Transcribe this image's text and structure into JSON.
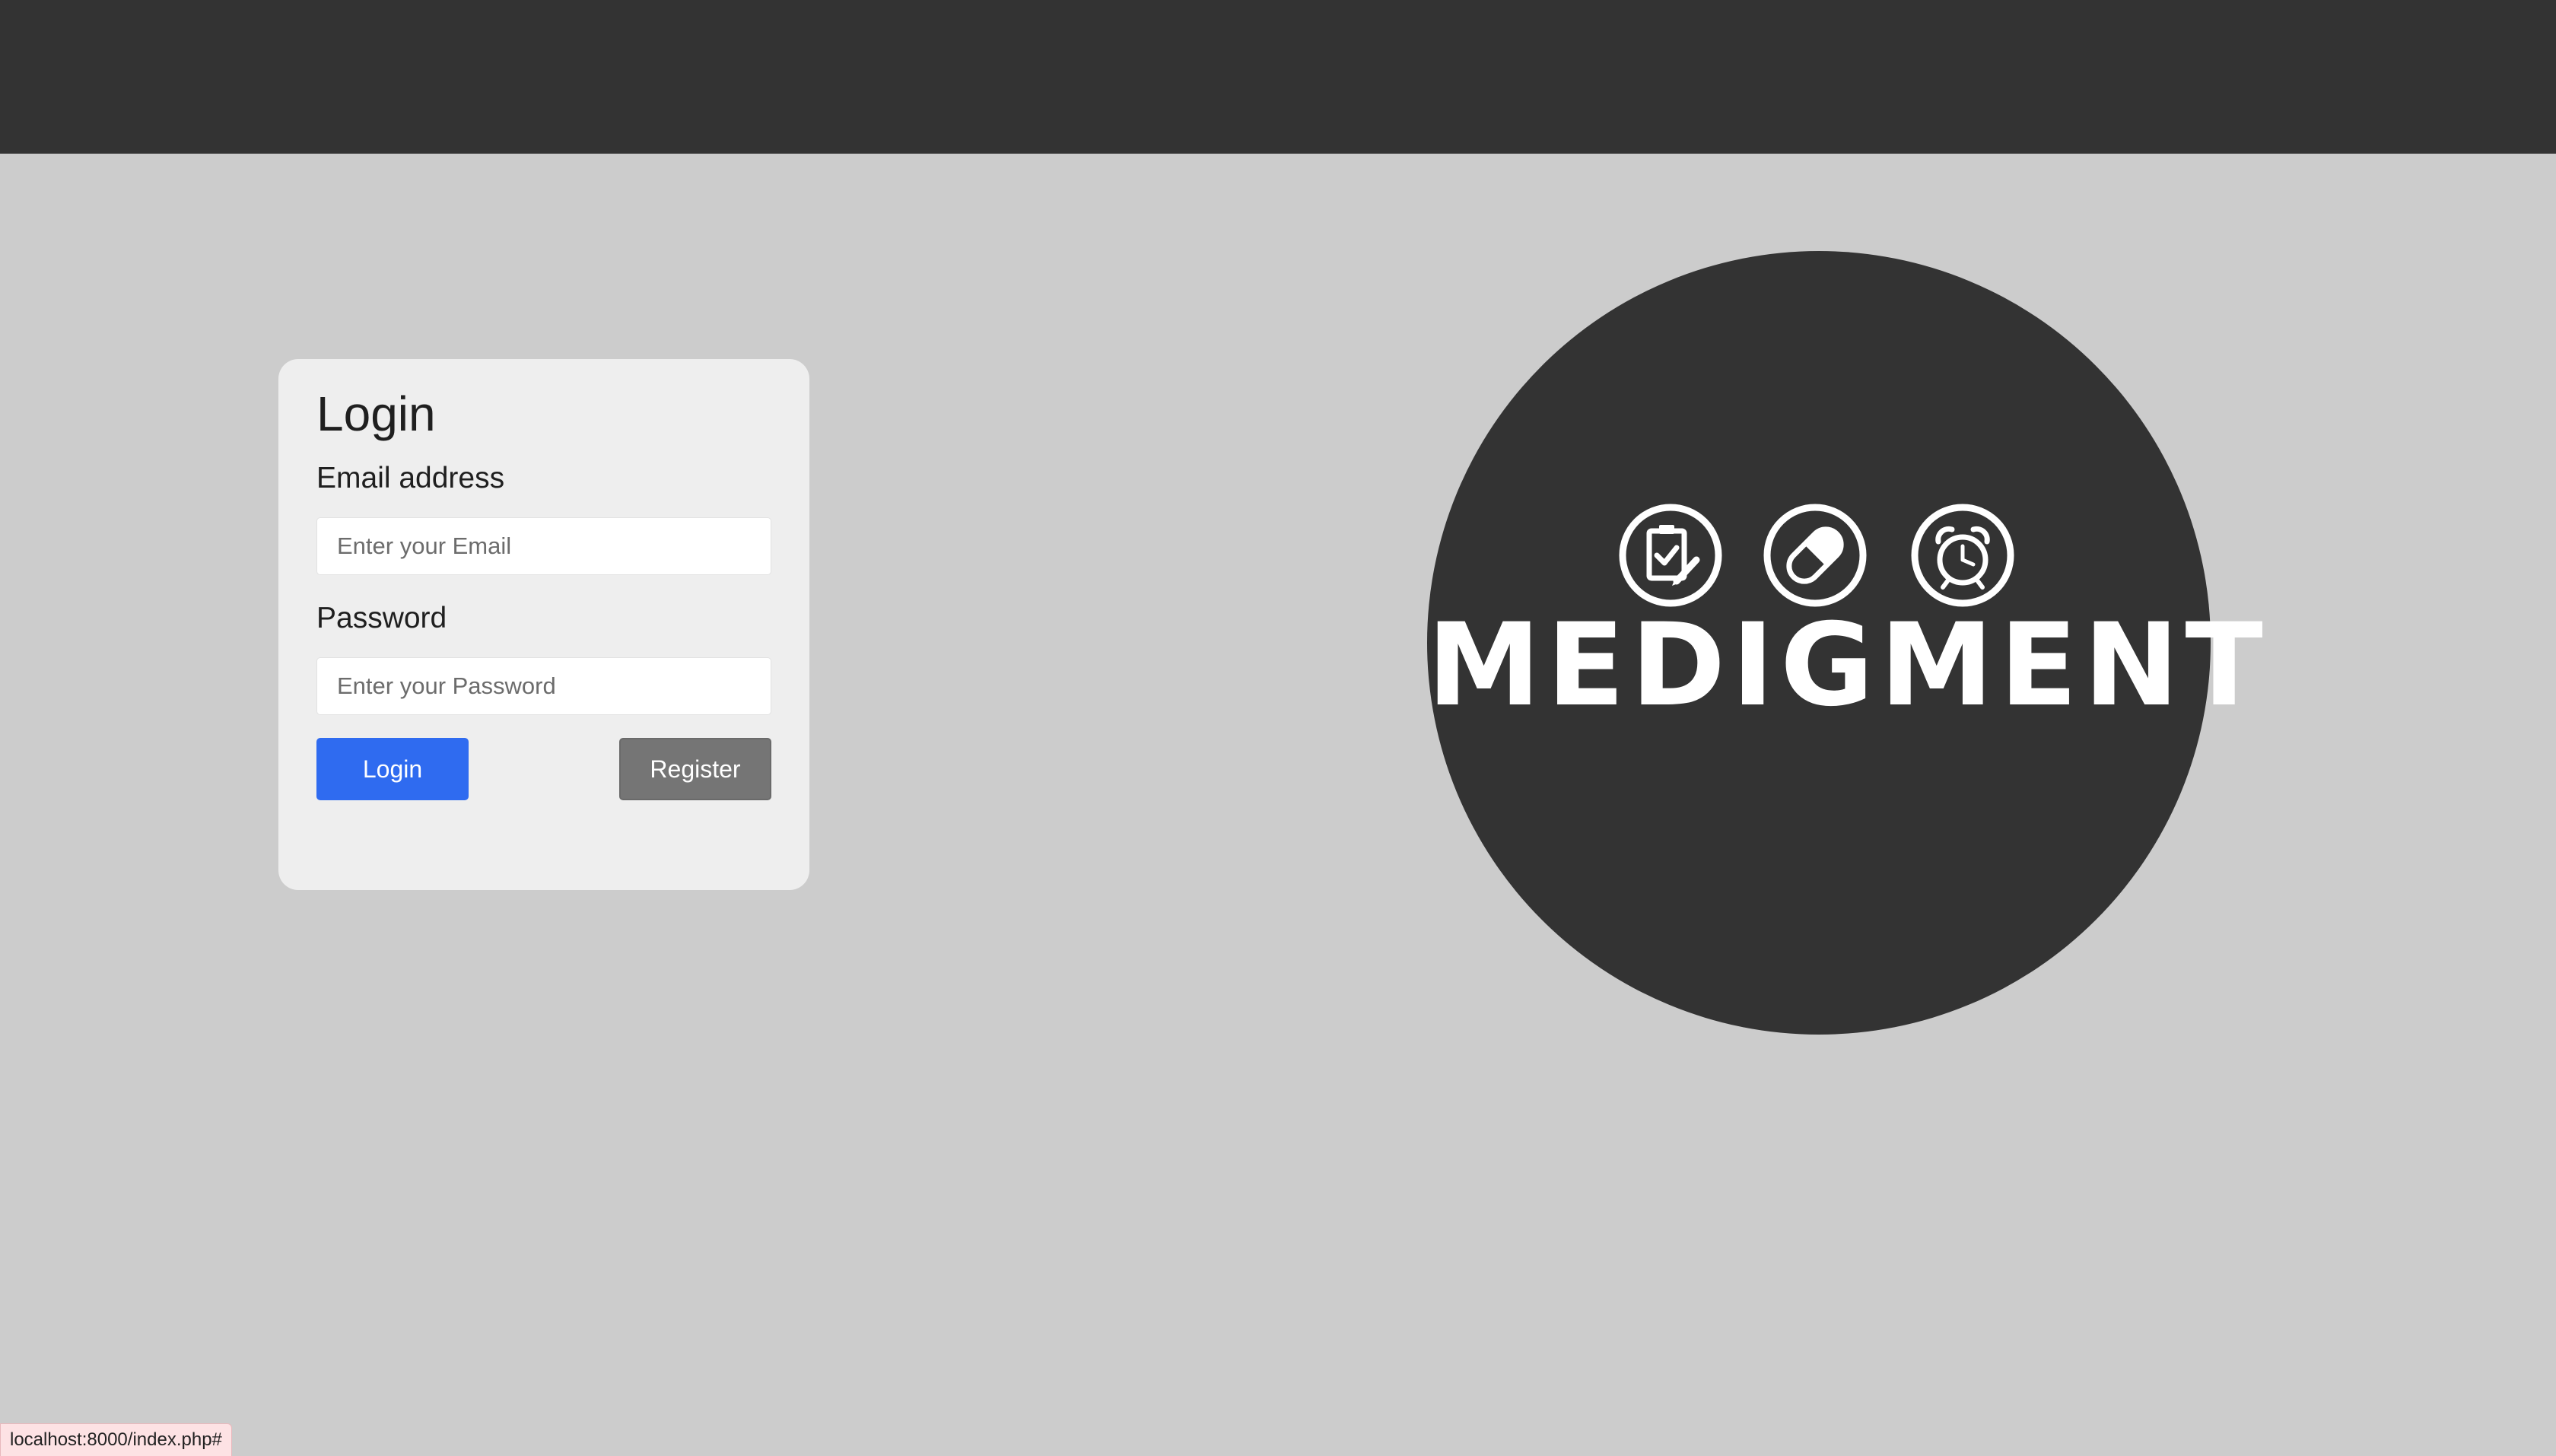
{
  "login": {
    "title": "Login",
    "email_label": "Email address",
    "email_placeholder": "Enter your Email",
    "email_value": "",
    "password_label": "Password",
    "password_placeholder": "Enter your Password",
    "password_value": "",
    "login_button": "Login",
    "register_button": "Register"
  },
  "logo": {
    "text": "MEDIGMENT",
    "icons": [
      "clipboard-check-icon",
      "pill-icon",
      "alarm-clock-icon"
    ]
  },
  "status_bar": {
    "url": "localhost:8000/index.php#"
  },
  "colors": {
    "topbar": "#333333",
    "background": "#cccccc",
    "card": "#eeeeee",
    "login_button": "#2f6bf0",
    "register_button": "#757575",
    "logo_circle": "#333333"
  }
}
